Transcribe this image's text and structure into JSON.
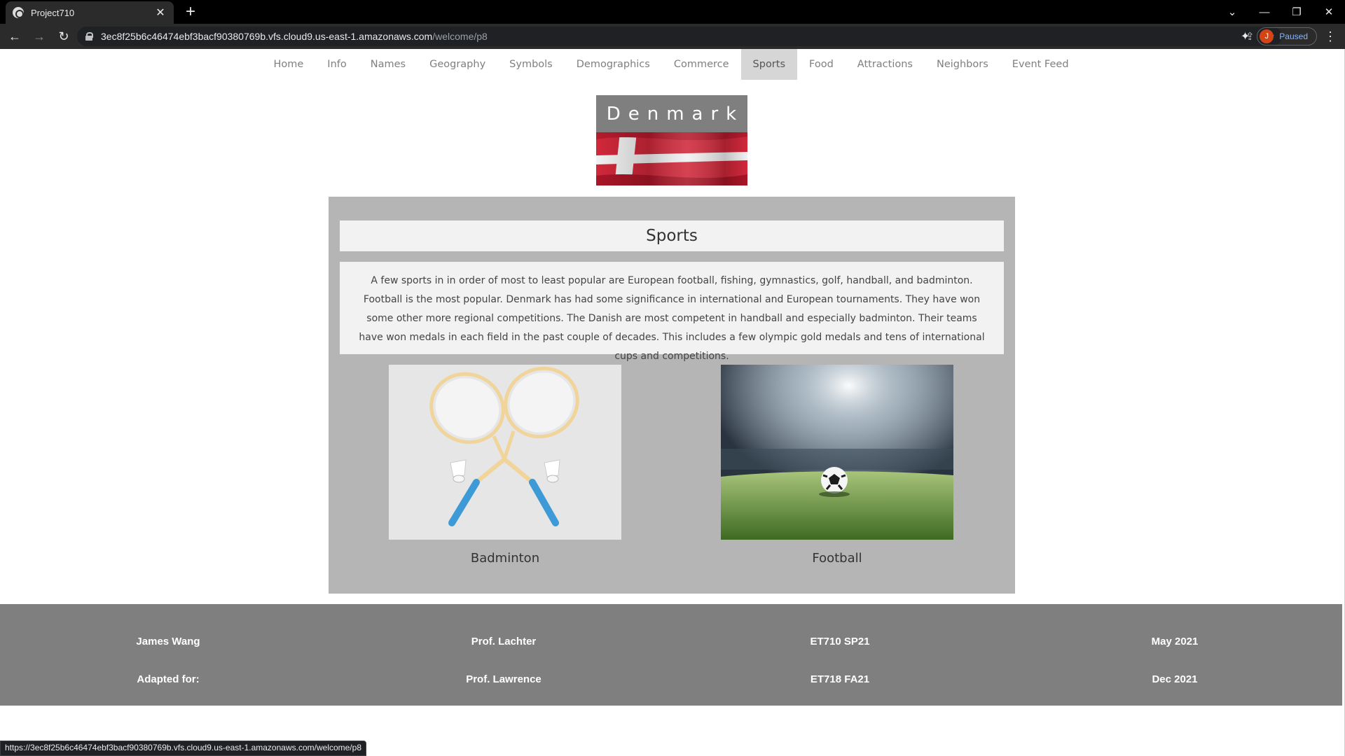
{
  "browser": {
    "tab_title": "Project710",
    "url_host": "3ec8f25b6c46474ebf3bacf90380769b.vfs.cloud9.us-east-1.amazonaws.com",
    "url_path": "/welcome/p8",
    "profile_initial": "J",
    "profile_status": "Paused",
    "status_url": "https://3ec8f25b6c46474ebf3bacf90380769b.vfs.cloud9.us-east-1.amazonaws.com/welcome/p8"
  },
  "nav": {
    "items": [
      {
        "label": "Home"
      },
      {
        "label": "Info"
      },
      {
        "label": "Names"
      },
      {
        "label": "Geography"
      },
      {
        "label": "Symbols"
      },
      {
        "label": "Demographics"
      },
      {
        "label": "Commerce"
      },
      {
        "label": "Sports"
      },
      {
        "label": "Food"
      },
      {
        "label": "Attractions"
      },
      {
        "label": "Neighbors"
      },
      {
        "label": "Event Feed"
      }
    ],
    "active": "Sports"
  },
  "header": {
    "country": "Denmark",
    "flag_colors": {
      "red": "#c8102e",
      "white": "#ffffff"
    }
  },
  "content": {
    "heading": "Sports",
    "paragraph": "A few sports in in order of most to least popular are European football, fishing, gymnastics, golf, handball, and badminton. Football is the most popular. Denmark has had some significance in international and European tournaments. They have won some other more regional competitions. The Danish are most competent in handball and especially badminton. Their teams have won medals in each field in the past couple of decades. This includes a few olympic gold medals and tens of international cups and competitions.",
    "images": [
      {
        "caption": "Badminton",
        "icon": "badminton-image"
      },
      {
        "caption": "Football",
        "icon": "football-image"
      }
    ]
  },
  "footer": {
    "row1": [
      "James Wang",
      "Prof. Lachter",
      "ET710 SP21",
      "May 2021"
    ],
    "row2": [
      "Adapted for:",
      "Prof. Lawrence",
      "ET718 FA21",
      "Dec 2021"
    ]
  },
  "colors": {
    "nav_active_bg": "#d6d6d6",
    "panel_bg": "#b5b5b5",
    "footer_bg": "#7f7f7f",
    "title_bg": "#7f7f7f"
  }
}
